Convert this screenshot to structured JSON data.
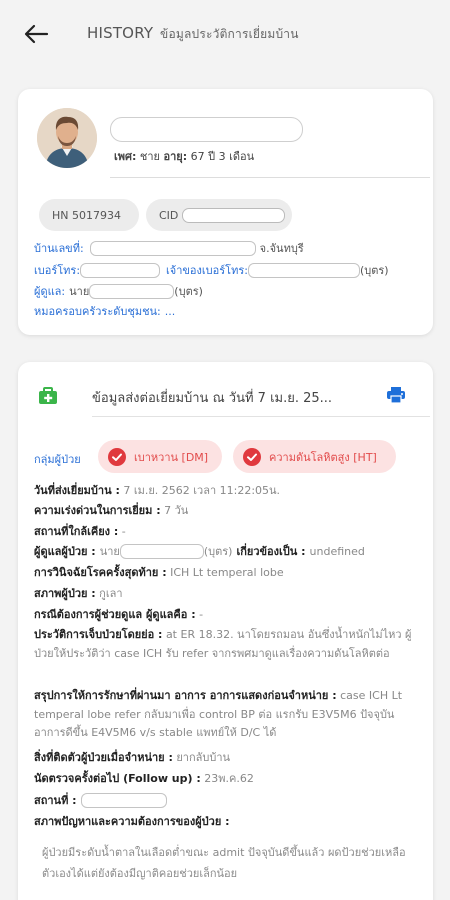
{
  "header": {
    "title_en": "HISTORY",
    "title_th": "ข้อมูลประวัติการเยี่ยมบ้าน"
  },
  "patient": {
    "sex_label": "เพศ:",
    "sex_value": "ชาย",
    "age_label": "อายุ:",
    "age_value": "67 ปี 3 เดือน",
    "hn": "HN 5017934",
    "cid_label": "CID",
    "address_label": "บ้านเลขที่:",
    "address_province": "จ.จันทบุรี",
    "phone_label": "เบอร์โทร:",
    "phone_owner_label": "เจ้าของเบอร์โทร:",
    "phone_owner_suffix": "(บุตร)",
    "caregiver_label": "ผู้ดูแล:",
    "caregiver_prefix": "นาย",
    "caregiver_suffix": "(บุตร)",
    "doctor_label": "หมอครอบครัวระดับชุมชน:",
    "doctor_value": "..."
  },
  "visit": {
    "header": "ข้อมูลส่งต่อเยี่ยมบ้าน ณ วันที่ 7 เม.ย. 25...",
    "group_label": "กลุ่มผู้ป่วย",
    "badges": [
      "เบาหวาน [DM]",
      "ความดันโลหิตสูง [HT]"
    ],
    "send_date_label": "วันที่ส่งเยี่ยมบ้าน :",
    "send_date_value": "7 เม.ย. 2562 เวลา 11:22:05น.",
    "urgency_label": "ความเร่งด่วนในการเยี่ยม :",
    "urgency_value": "7 วัน",
    "nearby_label": "สถานที่ใกล้เคียง :",
    "nearby_value": "-",
    "caregiver_label": "ผู้ดูแลผู้ป่วย :",
    "caregiver_prefix": "นาย",
    "caregiver_suffix": "(บุตร)",
    "relation_label": "เกี่ยวข้องเป็น :",
    "relation_value": "undefined",
    "diagnosis_label": "การวินิจฉัยโรคครั้งสุดท้าย :",
    "diagnosis_value": "ICH Lt temperal lobe",
    "status_label": "สภาพผู้ป่วย :",
    "status_value": "กูเลา",
    "needs_label": "กรณีต้องการผู้ช่วยดูแล ผู้ดูแลคือ :",
    "needs_value": "-",
    "history_label": "ประวัติการเจ็บป่วยโดยย่อ :",
    "history_value": "at ER 18.32. นาโดยรถมอน อันซึ่งน้ำหนักไม่ไหว ผู้ป่วยให้ประวัติว่า case ICH รับ refer จากรพศมาดูแลเรื่องความดันโลหิตต่อ",
    "summary_label": "สรุปการให้การรักษาที่ผ่านมา อาการ อาการแสดงก่อนจำหน่าย :",
    "summary_value": "case ICH Lt temperal lobe refer กลับมาเพื่อ control BP ต่อ แรกรับ E3V5M6 ปัจจุบัน อาการดีขึ้น E4V5M6 v/s stable แพทย์ให้ D/C ได้",
    "device_label": "สิ่งที่ติดตัวผู้ป่วยเมื่อจำหน่าย :",
    "device_value": "ยากลับบ้าน",
    "followup_label": "นัดตรวจครั้งต่อไป (Follow up) :",
    "followup_value": "23พ.ค.62",
    "place_label": "สถานที่ :",
    "problems_label": "สภาพปัญหาและความต้องการของผู้ป่วย :",
    "problems_value": "ผู้ป่วยมีระดับน้ำตาลในเลือดต่ำขณะ admit ปัจจุบันดีขึ้นแล้ว ผดป้วยช่วยเหลือตัวเองได้แต่ยังต้องมีญาติคอยช่วยเล็กน้อย"
  },
  "colors": {
    "accent_blue": "#2a6fd6",
    "badge_bg": "#fce2e2",
    "badge_red": "#e24b4b",
    "medical_green": "#3bb54a"
  }
}
